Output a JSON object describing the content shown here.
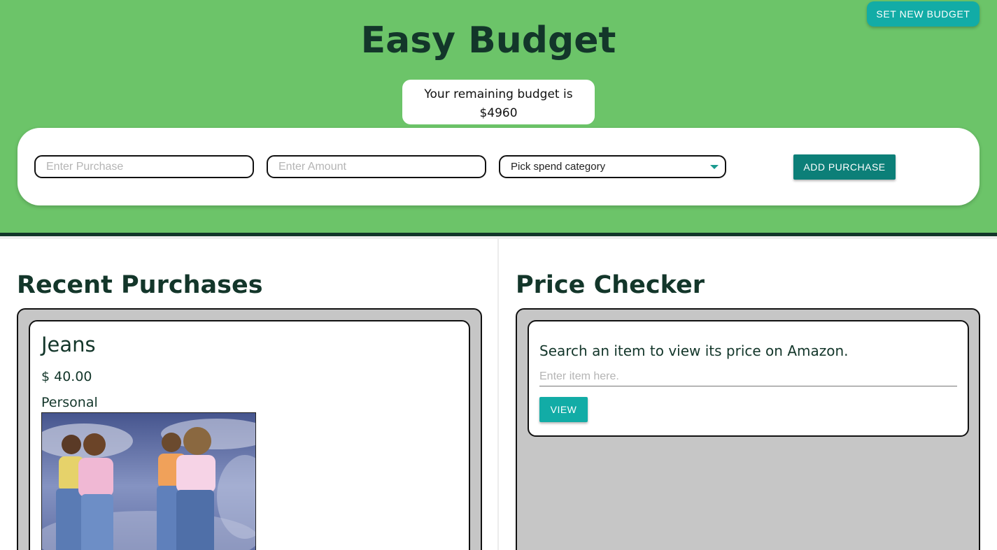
{
  "header": {
    "title": "Easy Budget",
    "set_budget_label": "SET NEW BUDGET",
    "budget_line1": "Your remaining budget is",
    "budget_line2": "$4960"
  },
  "form": {
    "purchase_placeholder": "Enter Purchase",
    "amount_placeholder": "Enter Amount",
    "category_selected": "Pick spend category",
    "add_label": "ADD PURCHASE"
  },
  "recent": {
    "title": "Recent Purchases",
    "items": [
      {
        "name": "Jeans",
        "price": "$ 40.00",
        "category": "Personal"
      }
    ]
  },
  "checker": {
    "title": "Price Checker",
    "prompt": "Search an item to view its price on Amazon.",
    "input_placeholder": "Enter item here.",
    "view_label": "VIEW"
  },
  "colors": {
    "header_bg": "#6cc469",
    "dark_green_text": "#13362a",
    "teal_button": "#12aca6",
    "dark_teal_button": "#0c7f78",
    "panel_bg": "#c6c6c6"
  }
}
